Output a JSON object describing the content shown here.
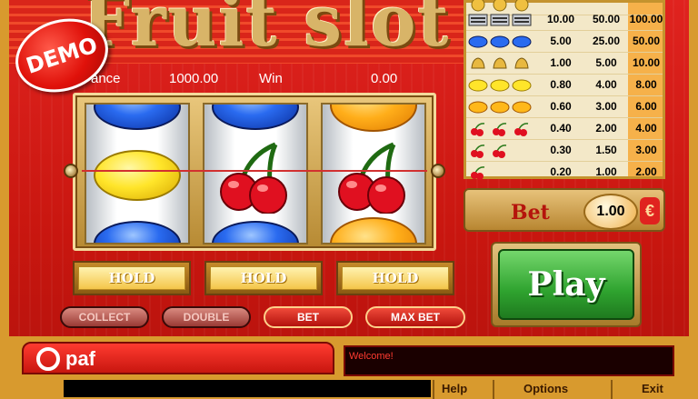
{
  "title": "Fruit slot",
  "badge": "DEMO",
  "balance": {
    "label": "ance",
    "value": "1000.00"
  },
  "win": {
    "label": "Win",
    "value": "0.00"
  },
  "paytable": {
    "rows": [
      {
        "symbol": "bar-icon",
        "c1": "10.00",
        "c2": "50.00",
        "c3": "100.00"
      },
      {
        "symbol": "blueberry-icon",
        "c1": "5.00",
        "c2": "25.00",
        "c3": "50.00"
      },
      {
        "symbol": "bell-icon",
        "c1": "1.00",
        "c2": "5.00",
        "c3": "10.00"
      },
      {
        "symbol": "lemon-icon",
        "c1": "0.80",
        "c2": "4.00",
        "c3": "8.00"
      },
      {
        "symbol": "orange-icon",
        "c1": "0.60",
        "c2": "3.00",
        "c3": "6.00"
      },
      {
        "symbol": "cherry-icon",
        "c1": "0.40",
        "c2": "2.00",
        "c3": "4.00"
      },
      {
        "symbol": "cherry-icon",
        "c1": "0.30",
        "c2": "1.50",
        "c3": "3.00"
      },
      {
        "symbol": "cherry-icon",
        "c1": "0.20",
        "c2": "1.00",
        "c3": "2.00"
      }
    ]
  },
  "bet": {
    "label": "Bet",
    "value": "1.00",
    "currency": "€"
  },
  "play_label": "Play",
  "hold_labels": [
    "HOLD",
    "HOLD",
    "HOLD"
  ],
  "buttons": {
    "collect": "COLLECT",
    "double": "DOUBLE",
    "bet": "BET",
    "max_bet": "MAX BET"
  },
  "brand": "paf",
  "message": "Welcome!",
  "footer": {
    "help": "Help",
    "options": "Options",
    "exit": "Exit"
  },
  "reels": [
    [
      "blueberry",
      "lemon",
      "blueberry"
    ],
    [
      "blueberry",
      "cherry",
      "blueberry"
    ],
    [
      "orange",
      "cherry",
      "orange"
    ]
  ]
}
